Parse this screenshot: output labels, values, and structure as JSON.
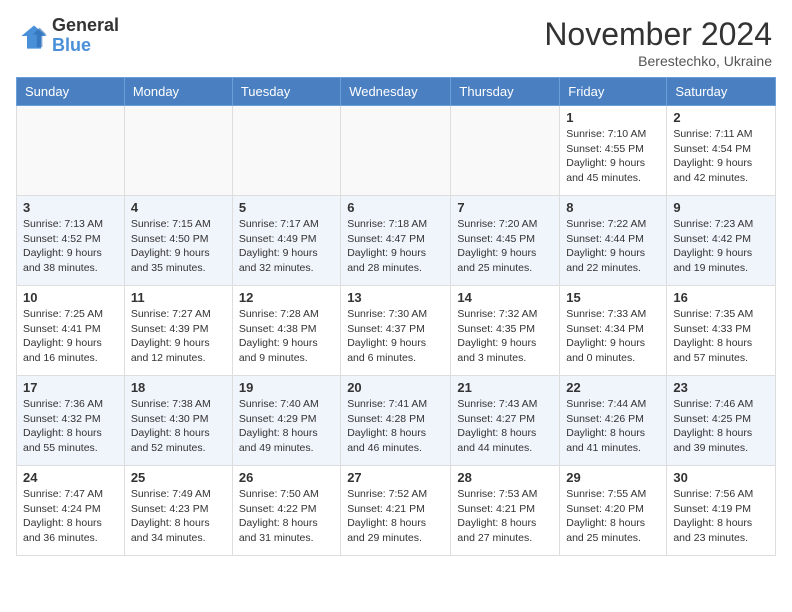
{
  "header": {
    "logo_general": "General",
    "logo_blue": "Blue",
    "month_title": "November 2024",
    "location": "Berestechko, Ukraine"
  },
  "days_of_week": [
    "Sunday",
    "Monday",
    "Tuesday",
    "Wednesday",
    "Thursday",
    "Friday",
    "Saturday"
  ],
  "weeks": [
    [
      {
        "day": "",
        "info": ""
      },
      {
        "day": "",
        "info": ""
      },
      {
        "day": "",
        "info": ""
      },
      {
        "day": "",
        "info": ""
      },
      {
        "day": "",
        "info": ""
      },
      {
        "day": "1",
        "info": "Sunrise: 7:10 AM\nSunset: 4:55 PM\nDaylight: 9 hours and 45 minutes."
      },
      {
        "day": "2",
        "info": "Sunrise: 7:11 AM\nSunset: 4:54 PM\nDaylight: 9 hours and 42 minutes."
      }
    ],
    [
      {
        "day": "3",
        "info": "Sunrise: 7:13 AM\nSunset: 4:52 PM\nDaylight: 9 hours and 38 minutes."
      },
      {
        "day": "4",
        "info": "Sunrise: 7:15 AM\nSunset: 4:50 PM\nDaylight: 9 hours and 35 minutes."
      },
      {
        "day": "5",
        "info": "Sunrise: 7:17 AM\nSunset: 4:49 PM\nDaylight: 9 hours and 32 minutes."
      },
      {
        "day": "6",
        "info": "Sunrise: 7:18 AM\nSunset: 4:47 PM\nDaylight: 9 hours and 28 minutes."
      },
      {
        "day": "7",
        "info": "Sunrise: 7:20 AM\nSunset: 4:45 PM\nDaylight: 9 hours and 25 minutes."
      },
      {
        "day": "8",
        "info": "Sunrise: 7:22 AM\nSunset: 4:44 PM\nDaylight: 9 hours and 22 minutes."
      },
      {
        "day": "9",
        "info": "Sunrise: 7:23 AM\nSunset: 4:42 PM\nDaylight: 9 hours and 19 minutes."
      }
    ],
    [
      {
        "day": "10",
        "info": "Sunrise: 7:25 AM\nSunset: 4:41 PM\nDaylight: 9 hours and 16 minutes."
      },
      {
        "day": "11",
        "info": "Sunrise: 7:27 AM\nSunset: 4:39 PM\nDaylight: 9 hours and 12 minutes."
      },
      {
        "day": "12",
        "info": "Sunrise: 7:28 AM\nSunset: 4:38 PM\nDaylight: 9 hours and 9 minutes."
      },
      {
        "day": "13",
        "info": "Sunrise: 7:30 AM\nSunset: 4:37 PM\nDaylight: 9 hours and 6 minutes."
      },
      {
        "day": "14",
        "info": "Sunrise: 7:32 AM\nSunset: 4:35 PM\nDaylight: 9 hours and 3 minutes."
      },
      {
        "day": "15",
        "info": "Sunrise: 7:33 AM\nSunset: 4:34 PM\nDaylight: 9 hours and 0 minutes."
      },
      {
        "day": "16",
        "info": "Sunrise: 7:35 AM\nSunset: 4:33 PM\nDaylight: 8 hours and 57 minutes."
      }
    ],
    [
      {
        "day": "17",
        "info": "Sunrise: 7:36 AM\nSunset: 4:32 PM\nDaylight: 8 hours and 55 minutes."
      },
      {
        "day": "18",
        "info": "Sunrise: 7:38 AM\nSunset: 4:30 PM\nDaylight: 8 hours and 52 minutes."
      },
      {
        "day": "19",
        "info": "Sunrise: 7:40 AM\nSunset: 4:29 PM\nDaylight: 8 hours and 49 minutes."
      },
      {
        "day": "20",
        "info": "Sunrise: 7:41 AM\nSunset: 4:28 PM\nDaylight: 8 hours and 46 minutes."
      },
      {
        "day": "21",
        "info": "Sunrise: 7:43 AM\nSunset: 4:27 PM\nDaylight: 8 hours and 44 minutes."
      },
      {
        "day": "22",
        "info": "Sunrise: 7:44 AM\nSunset: 4:26 PM\nDaylight: 8 hours and 41 minutes."
      },
      {
        "day": "23",
        "info": "Sunrise: 7:46 AM\nSunset: 4:25 PM\nDaylight: 8 hours and 39 minutes."
      }
    ],
    [
      {
        "day": "24",
        "info": "Sunrise: 7:47 AM\nSunset: 4:24 PM\nDaylight: 8 hours and 36 minutes."
      },
      {
        "day": "25",
        "info": "Sunrise: 7:49 AM\nSunset: 4:23 PM\nDaylight: 8 hours and 34 minutes."
      },
      {
        "day": "26",
        "info": "Sunrise: 7:50 AM\nSunset: 4:22 PM\nDaylight: 8 hours and 31 minutes."
      },
      {
        "day": "27",
        "info": "Sunrise: 7:52 AM\nSunset: 4:21 PM\nDaylight: 8 hours and 29 minutes."
      },
      {
        "day": "28",
        "info": "Sunrise: 7:53 AM\nSunset: 4:21 PM\nDaylight: 8 hours and 27 minutes."
      },
      {
        "day": "29",
        "info": "Sunrise: 7:55 AM\nSunset: 4:20 PM\nDaylight: 8 hours and 25 minutes."
      },
      {
        "day": "30",
        "info": "Sunrise: 7:56 AM\nSunset: 4:19 PM\nDaylight: 8 hours and 23 minutes."
      }
    ]
  ]
}
